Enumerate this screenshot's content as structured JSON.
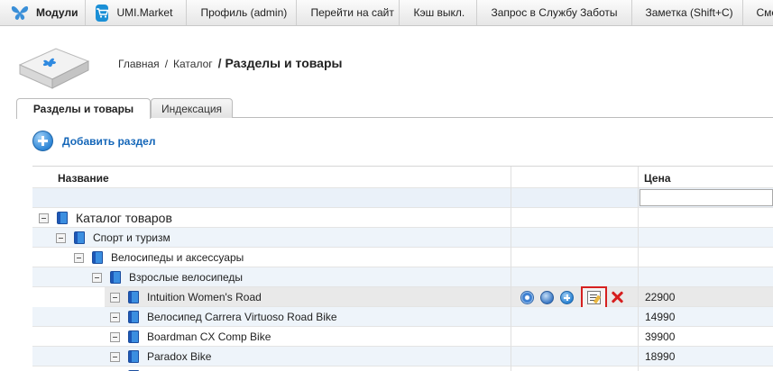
{
  "topbar": {
    "modules_label": "Модули",
    "items": [
      "UMI.Market",
      "Профиль (admin)",
      "Перейти на сайт",
      "Кэш выкл.",
      "Запрос в Службу Заботы",
      "Заметка (Shift+C)",
      "Смена"
    ]
  },
  "breadcrumb": {
    "home": "Главная",
    "sep1": "/",
    "catalog": "Каталог",
    "sep2": "/",
    "current": "Разделы и товары"
  },
  "tabs": [
    "Разделы и товары",
    "Индексация"
  ],
  "add_section_label": "Добавить раздел",
  "table": {
    "col_name": "Название",
    "col_price": "Цена",
    "rows": [
      {
        "label": "Каталог товаров",
        "price": ""
      },
      {
        "label": "Спорт и туризм",
        "price": ""
      },
      {
        "label": "Велосипеды и аксессуары",
        "price": ""
      },
      {
        "label": "Взрослые велосипеды",
        "price": ""
      },
      {
        "label": "Intuition Women's Road",
        "price": "22900"
      },
      {
        "label": "Велосипед Carrera Virtuoso Road Bike",
        "price": "14990"
      },
      {
        "label": "Boardman CX Comp Bike",
        "price": "39900"
      },
      {
        "label": "Paradox Bike",
        "price": "18990"
      }
    ]
  },
  "colors": {
    "accent_blue": "#1466b8",
    "highlight_red": "#d62020",
    "filter_row_bg": "#eaf1f9"
  }
}
